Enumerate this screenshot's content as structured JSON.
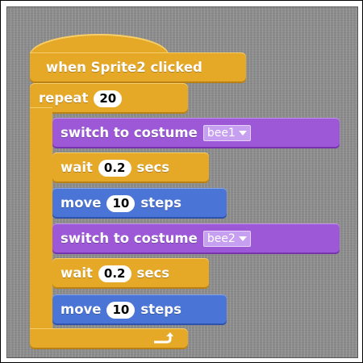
{
  "script": {
    "hat_label": "when Sprite2 clicked",
    "repeat_label": "repeat",
    "repeat_count": "20",
    "blocks": [
      {
        "text": "switch to costume",
        "costume": "bee1"
      },
      {
        "text": "wait",
        "value": "0.2",
        "unit": "secs"
      },
      {
        "text": "move",
        "value": "10",
        "unit": "steps"
      },
      {
        "text": "switch to costume",
        "costume": "bee2"
      },
      {
        "text": "wait",
        "value": "0.2",
        "unit": "secs"
      },
      {
        "text": "move",
        "value": "10",
        "unit": "steps"
      }
    ]
  },
  "colors": {
    "control": "#e6a827",
    "looks": "#9c58d6",
    "motion": "#4a74d6",
    "background": "#8c8c8c"
  },
  "icons": {
    "loop_arrow": "repeat-arrow-icon",
    "dropdown": "dropdown-arrow-icon"
  }
}
